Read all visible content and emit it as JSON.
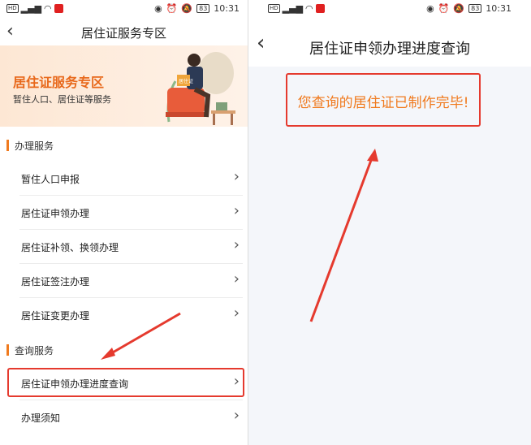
{
  "left": {
    "status_time": "10:31",
    "battery": "83",
    "hd": "HD",
    "nav_title": "居住证服务专区",
    "banner_title": "居住证服务专区",
    "banner_subtitle": "暂住人口、居住证等服务",
    "banner_book": "居住证",
    "section1": "办理服务",
    "items1": [
      "暂住人口申报",
      "居住证申领办理",
      "居住证补领、换领办理",
      "居住证签注办理",
      "居住证变更办理"
    ],
    "section2": "查询服务",
    "items2": [
      "居住证申领办理进度查询",
      "办理须知"
    ]
  },
  "right": {
    "status_time": "10:31",
    "battery": "83",
    "hd": "HD",
    "nav_title": "居住证申领办理进度查询",
    "message": "您查询的居住证已制作完毕!"
  },
  "colors": {
    "accent": "#f07a1e",
    "highlight": "#e53a2e"
  }
}
